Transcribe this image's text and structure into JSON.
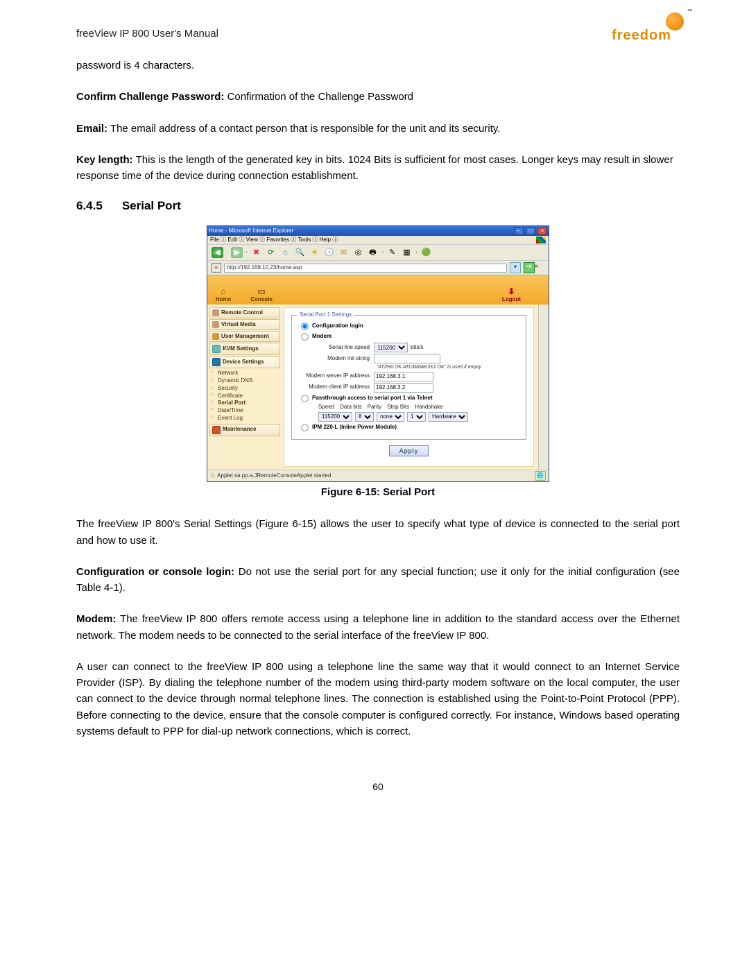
{
  "doc": {
    "header_title": "freeView IP 800 User's Manual",
    "logo_text": "freedom",
    "page_number": "60"
  },
  "body": {
    "p1": "password is 4 characters.",
    "p2_label": "Confirm Challenge Password:",
    "p2_text": " Confirmation of the Challenge Password",
    "p3_label": "Email:",
    "p3_text": " The email address of a contact person that is responsible for the unit and its security.",
    "p4_label": "Key length:",
    "p4_text": " This is the length of the generated key in bits. 1024 Bits is sufficient for most cases. Longer keys may result in slower response time of the device during connection establishment.",
    "section_num": "6.4.5",
    "section_title": "Serial Port",
    "fig_caption": "Figure 6-15: Serial Port",
    "p5": "The freeView IP 800's Serial Settings (Figure 6-15) allows the user to specify what type of device is connected to the serial port and how to use it.",
    "p6_label": "Configuration or console login:",
    "p6_text": " Do not use the serial port for any special function; use it only for the initial configuration (see Table 4-1).",
    "p7_label": "Modem:",
    "p7_text": " The freeView IP 800 offers remote access using a telephone line in addition to the standard access over the Ethernet network. The modem needs to be connected to the serial interface of the freeView IP 800.",
    "p8": "A user can connect to the freeView IP 800 using a telephone line the same way that it would connect to an Internet Service Provider (ISP). By dialing the telephone number of the modem using third-party modem software on the local computer, the user can connect to the device through normal telephone lines. The connection is established using the Point-to-Point Protocol (PPP). Before connecting to the device, ensure that the console computer is configured correctly. For instance, Windows based operating systems default to PPP for dial-up network connections, which is correct."
  },
  "ie": {
    "title": "Home - Microsoft Internet Explorer",
    "menus": "File ⓘ  Edit ⓘ  View ⓘ  Favorites ⓘ  Tools ⓘ  Help ⓘ",
    "url": "http://192.168.10.23/home.asp",
    "status": "Applet sa.pp.a.JRemoteConsoleApplet started"
  },
  "app": {
    "nav_home": "Home",
    "nav_console": "Console",
    "nav_logout": "Logout"
  },
  "sidebar": {
    "remote_control": "Remote Control",
    "virtual_media": "Virtual Media",
    "user_management": "User Management",
    "kvm_settings": "KVM Settings",
    "device_settings": "Device Settings",
    "sub_network": "Network",
    "sub_dyndns": "Dynamic DNS",
    "sub_security": "Security",
    "sub_certificate": "Certificate",
    "sub_serial": "Serial Port",
    "sub_datetime": "Date/Time",
    "sub_eventlog": "Event Log",
    "maintenance": "Maintenance"
  },
  "panel": {
    "legend": "Serial Port 1 Settings",
    "opt_config": "Configuration login",
    "opt_modem": "Modem",
    "serial_speed_lab": "Serial line speed",
    "serial_speed_val": "115200",
    "serial_speed_unit": "bits/s",
    "modem_init_lab": "Modem init string",
    "modem_init_val": "",
    "modem_hint": "\"ATZH0 OK ATL0M0&K3X1 OK\" is used if empty",
    "server_ip_lab": "Modem server IP address",
    "server_ip_val": "192.168.3.1",
    "client_ip_lab": "Modem client IP address",
    "client_ip_val": "192.168.3.2",
    "opt_passthrough": "Passthrough access to serial port 1 via Telnet",
    "pt_speed_lab": "Speed",
    "pt_speed_val": "115200",
    "pt_databits_lab": "Data bits",
    "pt_databits_val": "8",
    "pt_parity_lab": "Parity",
    "pt_parity_val": "none",
    "pt_stopbits_lab": "Stop Bits",
    "pt_stopbits_val": "1",
    "pt_handshake_lab": "Handshake",
    "pt_handshake_val": "Hardware",
    "opt_ipm": "IPM 220-L (Inline Power Module)",
    "apply": "Apply"
  }
}
